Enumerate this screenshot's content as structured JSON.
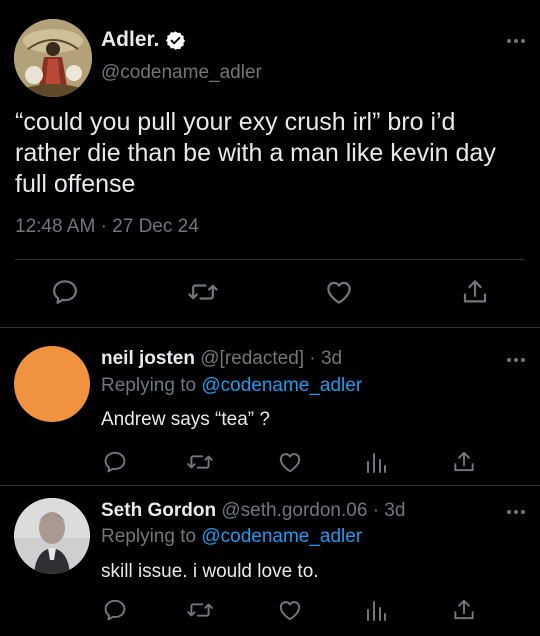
{
  "colors": {
    "background": "#000000",
    "text_primary": "#e7e9ea",
    "text_secondary": "#71767b",
    "link": "#1d9bf0",
    "divider": "#2f3336"
  },
  "main_tweet": {
    "author": {
      "name": "Adler.",
      "handle": "@codename_adler",
      "verified": true
    },
    "text": "“could you pull your exy crush irl” bro i’d rather die than be with a man like kevin day full offense",
    "time": "12:48 AM",
    "separator": "·",
    "date": "27 Dec 24",
    "actions": [
      "reply-icon",
      "retweet-icon",
      "like-icon",
      "share-icon"
    ]
  },
  "replies": [
    {
      "name": "neil josten",
      "handle": "@[redacted]",
      "separator": "·",
      "age": "3d",
      "replying_prefix": "Replying to",
      "replying_to": "@codename_adler",
      "text": "Andrew says “tea” ?",
      "avatar_color": "#f0923e",
      "actions": [
        "reply-icon",
        "retweet-icon",
        "like-icon",
        "analytics-icon",
        "share-icon"
      ]
    },
    {
      "name": "Seth Gordon",
      "handle": "@seth.gordon.06",
      "separator": "·",
      "age": "3d",
      "replying_prefix": "Replying to",
      "replying_to": "@codename_adler",
      "text": "skill issue. i would love to.",
      "actions": [
        "reply-icon",
        "retweet-icon",
        "like-icon",
        "analytics-icon",
        "share-icon"
      ]
    }
  ]
}
